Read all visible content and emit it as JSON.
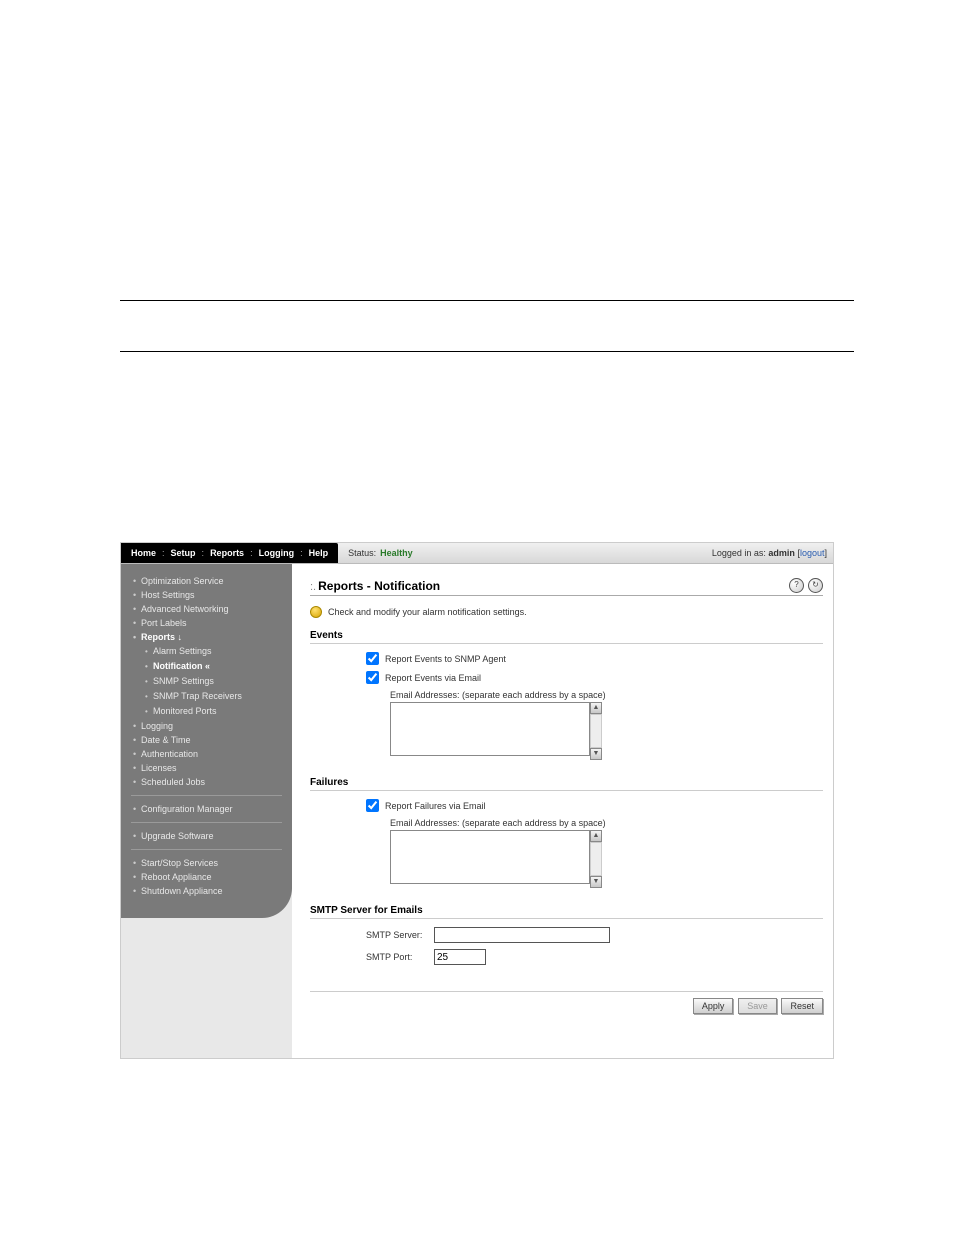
{
  "topnav": {
    "home": "Home",
    "setup": "Setup",
    "reports": "Reports",
    "logging": "Logging",
    "help": "Help"
  },
  "status": {
    "label": "Status:",
    "value": "Healthy"
  },
  "login": {
    "prefix": "Logged in as:",
    "user": "admin",
    "lb": "[ ",
    "logout": "logout",
    "rb": " ]"
  },
  "sidebar": {
    "optimization": "Optimization Service",
    "host": "Host Settings",
    "advnet": "Advanced Networking",
    "portlabels": "Port Labels",
    "reports": "Reports ↓",
    "alarm": "Alarm Settings",
    "notification": "Notification «",
    "snmpset": "SNMP Settings",
    "snmptrap": "SNMP Trap Receivers",
    "monports": "Monitored Ports",
    "logging": "Logging",
    "datetime": "Date & Time",
    "auth": "Authentication",
    "licenses": "Licenses",
    "sched": "Scheduled Jobs",
    "confmgr": "Configuration Manager",
    "upgrade": "Upgrade Software",
    "startstop": "Start/Stop Services",
    "reboot": "Reboot Appliance",
    "shutdown": "Shutdown Appliance"
  },
  "page": {
    "title": "Reports - Notification",
    "hint": "Check and modify your alarm notification settings."
  },
  "events": {
    "header": "Events",
    "snmp_label": "Report Events to SNMP Agent",
    "snmp_checked": true,
    "email_label": "Report Events via Email",
    "email_checked": true,
    "addr_label": "Email Addresses: (separate each address by a space)",
    "addr_value": ""
  },
  "failures": {
    "header": "Failures",
    "email_label": "Report Failures via Email",
    "email_checked": true,
    "addr_label": "Email Addresses: (separate each address by a space)",
    "addr_value": ""
  },
  "smtp": {
    "header": "SMTP Server for Emails",
    "server_label": "SMTP Server:",
    "server_value": "",
    "port_label": "SMTP Port:",
    "port_value": "25"
  },
  "buttons": {
    "apply": "Apply",
    "save": "Save",
    "reset": "Reset"
  }
}
